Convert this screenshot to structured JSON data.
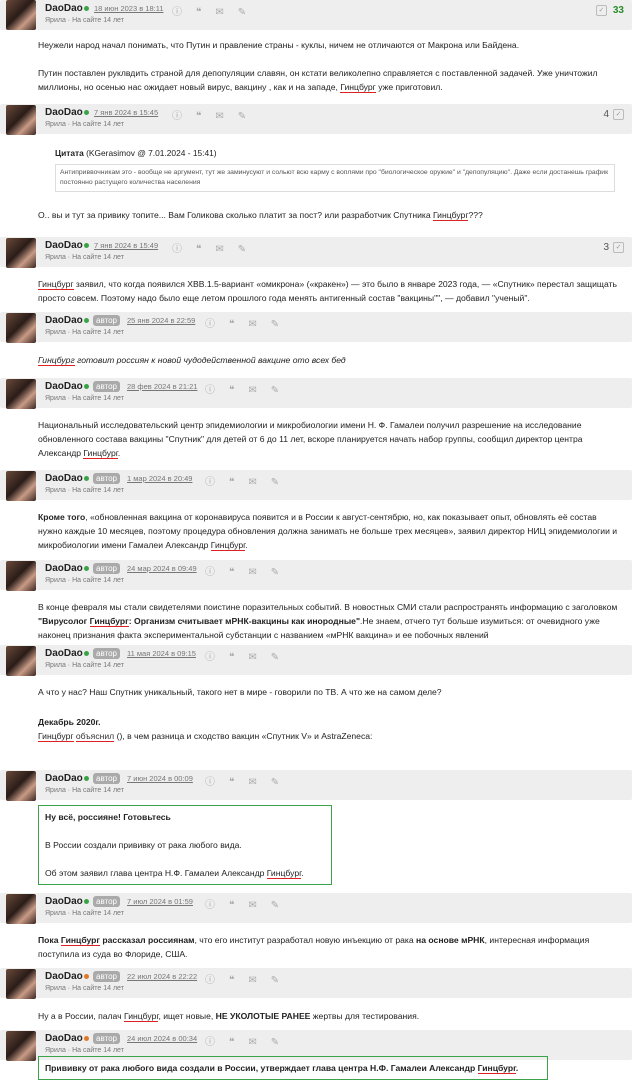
{
  "common": {
    "username": "DaoDao",
    "sub_prefix": "Ярила",
    "sub_status": "На сайте 14 лет",
    "author_badge": "автор"
  },
  "posts": [
    {
      "date": "18 июн 2023 в 18:11",
      "rating": "33",
      "p1": "Неужели народ начал понимать, что Путин и правление страны - куклы, ничем не отличаются от Макрона или Байдена.",
      "p2a": "Путин поставлен руклвдить страной для депопуляции славян, он кстати великолепно справляется с поставленной задачей. Уже уничтожил миллионы, но осенью нас ожидает новый вирус, вакцину , как и на западе, ",
      "p2u": "Гинцбург",
      "p2b": " уже приготовил."
    },
    {
      "date": "7 янв 2024 в 15:45",
      "rating": "4",
      "quote_label": "Цитата",
      "quote_src": " (KGerasimov @ 7.01.2024 - 15:41)",
      "quote_text": "Антиприввочникам это - вообще не аргумент, тут же заминусуют и сольют всю карму с воплями про \"биологическое оружие\" и \"депопуляцию\". Даже если достанешь график постоянно растущего количества населения",
      "p1a": "О.. вы и тут за привику топите... Вам Голикова сколько платит за пост? или разработчик Спутника ",
      "p1u": "Гинцбург",
      "p1b": "???"
    },
    {
      "date": "7 янв 2024 в 15:49",
      "rating": "3",
      "p1u": "Гинцбург",
      "p1b": " заявил, что когда появился XBB.1.5-вариант «омикрона» («кракен») — это было в январе 2023 года, — «Спутник» перестал защищать просто совсем. Поэтому надо было еще летом прошлого года менять антигенный состав \"вакцины\"\", — добавил \"ученый\"."
    },
    {
      "date": "25 янв 2024 в 22:59",
      "p1u": "Гинцбург",
      "p1b": " готовит россиян к новой чудодейственной вакцине ото всех бед"
    },
    {
      "date": "28 фев 2024 в 21:21",
      "p1a": "Национальный исследовательский центр эпидемиологии и микробиологии имени Н. Ф. Гамалеи получил разрешение на исследование обновленного состава вакцины \"Спутник\" для детей от 6 до 11 лет, вскоре планируется начать набор группы, сообщил директор центра Александр ",
      "p1u": "Гинцбург",
      "p1b": "."
    },
    {
      "date": "1 мар 2024 в 20:49",
      "p1bold": "Кроме того",
      "p1a": ", «обновленная вакцина от коронавируса появится и в России к август-сентябрю, но, как показывает опыт, обновлять её состав нужно каждые 10 месяцев, поэтому процедура обновления должна занимать не больше трех месяцев», заявил директор НИЦ эпидемиологии и микробиологии имени Гамалеи Александр ",
      "p1u": "Гинцбург",
      "p1b": "."
    },
    {
      "date": "24 мар 2024 в 09:49",
      "p1a": "В конце февраля мы стали свидетелями поистине поразительных событий. В новостных СМИ стали распространять информацию с заголовком ",
      "p1q1": "\"Вирусолог ",
      "p1u": "Гинцбург",
      "p1q2": ": Организм считывает мРНК-вакцины как инородные\"",
      "p1b": ".Не знаем, отчего тут больше изумиться: от очевидного уже наконец признания факта экспериментальной субстанции с названием «мРНК вакцина» и ее побочных явлений"
    },
    {
      "date": "11 мая 2024 в 09:15",
      "p1": "А что у нас? Наш Спутник уникальный, такого нет в мире - говорили по ТВ. А что же на самом деле?",
      "p2": "Декабрь 2020г.",
      "p3u": "Гинцбург",
      "p3link": "объяснил",
      "p3b": " (), в чем разница и сходство вакцин «Спутник V» и AstraZeneca:"
    },
    {
      "date": "7 июн 2024 в 00:09",
      "p1": "Ну всё, россияне! Готовьтесь",
      "p2": "В России создали прививку от рака любого вида.",
      "p3a": "Об этом заявил глава центра Н.Ф. Гамалеи Александр ",
      "p3u": "Гинцбург",
      "p3b": "."
    },
    {
      "date": "7 июл 2024 в 01:59",
      "p1bold1": "Пока ",
      "p1u": "Гинцбург",
      "p1bold2": " рассказал россиянам",
      "p1a": ", что его институт разработал новую инъекцию от рака ",
      "p1bold3": "на основе мРНК",
      "p1b": ", интересная информация поступила из суда во Флориде, США."
    },
    {
      "date": "22 июл 2024 в 22:22",
      "p1a": "Ну а в России, палач ",
      "p1u": "Гинцбург",
      "p1b": ", ищет новые, ",
      "p1bold": "НЕ УКОЛОТЫЕ РАНЕЕ",
      "p1c": " жертвы для тестирования."
    },
    {
      "date": "24 июл 2024 в 00:34",
      "p1a": "Прививку от рака любого вида создали в России, утверждает глава центра Н.Ф. Гамалеи Александр ",
      "p1u": "Гинцбург",
      "p1b": "."
    }
  ]
}
